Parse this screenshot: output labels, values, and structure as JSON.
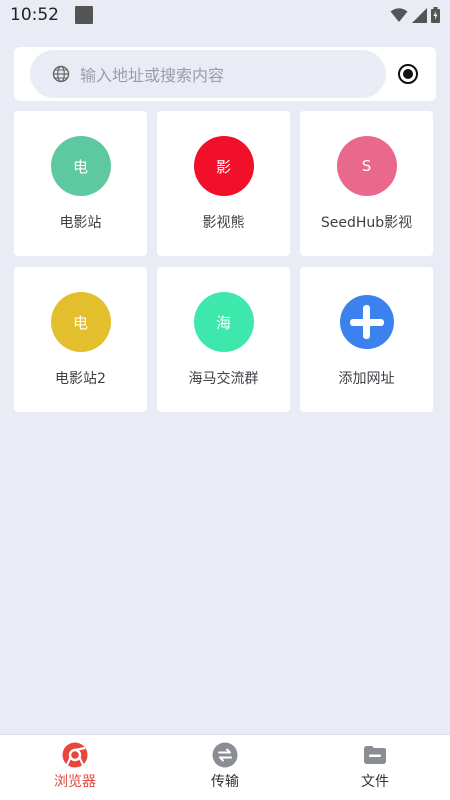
{
  "status_bar": {
    "time": "10:52",
    "icons": [
      "notification-square-icon",
      "wifi-icon",
      "signal-icon",
      "battery-icon"
    ]
  },
  "search": {
    "placeholder": "输入地址或搜索内容",
    "icon": "globe-icon",
    "action_icon": "record-icon"
  },
  "tiles": [
    {
      "letter": "电",
      "label": "电影站",
      "color": "#5ec8a0"
    },
    {
      "letter": "影",
      "label": "影视熊",
      "color": "#f0102a"
    },
    {
      "letter": "S",
      "label": "SeedHub影视",
      "color": "#e8698c"
    },
    {
      "letter": "电",
      "label": "电影站2",
      "color": "#e3bf2e"
    },
    {
      "letter": "海",
      "label": "海马交流群",
      "color": "#3ee8ad"
    },
    {
      "label": "添加网址",
      "icon": "plus-circle-icon",
      "color": "#3b82ef"
    }
  ],
  "bottom_nav": {
    "items": [
      {
        "label": "浏览器",
        "icon": "browser-icon",
        "active": true,
        "color": "#e8453c"
      },
      {
        "label": "传输",
        "icon": "transfer-icon",
        "active": false,
        "color": "#8a8d93"
      },
      {
        "label": "文件",
        "icon": "folder-icon",
        "active": false,
        "color": "#8a8d93"
      }
    ]
  }
}
